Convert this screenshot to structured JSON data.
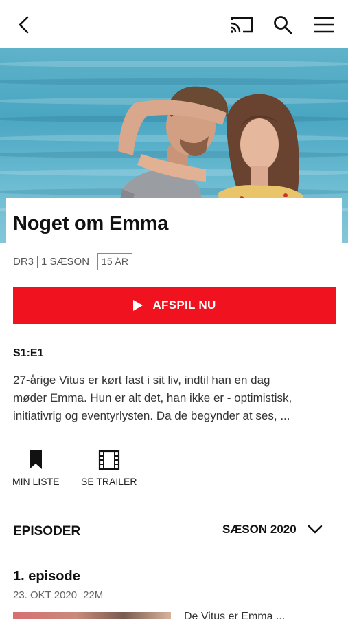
{
  "header": {
    "back_icon": "chevron-left-icon",
    "cast_icon": "cast-icon",
    "search_icon": "search-icon",
    "menu_icon": "hamburger-menu-icon"
  },
  "show": {
    "title": "Noget om Emma",
    "channel": "DR3",
    "seasons": "1 SÆSON",
    "age_rating": "15 ÅR"
  },
  "play_button": {
    "label": "AFSPIL NU",
    "icon": "play-icon",
    "color": "#f0131f"
  },
  "episode_info": {
    "code": "S1:E1",
    "description_lines": [
      "27-årige Vitus er kørt fast i sit liv, indtil han en dag",
      "møder Emma. Hun er alt det, han ikke er - optimistisk,",
      "initiativrig og eventyrlysten. Da de begynder at ses, ..."
    ]
  },
  "actions": [
    {
      "label": "MIN LISTE",
      "icon": "bookmark-icon"
    },
    {
      "label": "SE TRAILER",
      "icon": "film-icon"
    }
  ],
  "episodes": {
    "heading": "EPISODER",
    "season_select": "SÆSON 2020",
    "list": [
      {
        "title": "1. episode",
        "date": "23. OKT 2020",
        "duration": "22M",
        "description_start": "De Vitus er Emma ..."
      }
    ]
  }
}
